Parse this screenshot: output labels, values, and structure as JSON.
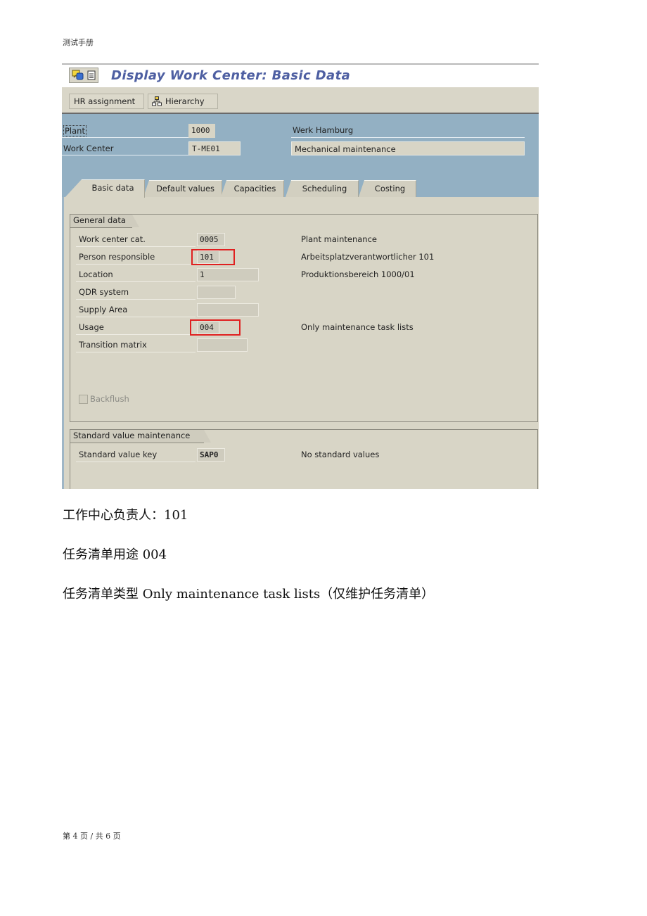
{
  "document": {
    "header": "测试手册",
    "footer": "第 4 页 / 共 6 页"
  },
  "sap": {
    "title": "Display Work Center: Basic Data",
    "title_icons": [
      "help-icon",
      "document-icon"
    ],
    "toolbar": {
      "hr_assignment": "HR assignment",
      "hierarchy": "Hierarchy"
    },
    "header": {
      "plant_label": "Plant",
      "plant_value": "1000",
      "plant_desc": "Werk Hamburg",
      "work_center_label": "Work Center",
      "work_center_value": "T-ME01",
      "work_center_desc": "Mechanical maintenance"
    },
    "tabs": [
      {
        "label": "Basic data",
        "active": true
      },
      {
        "label": "Default values",
        "active": false
      },
      {
        "label": "Capacities",
        "active": false
      },
      {
        "label": "Scheduling",
        "active": false
      },
      {
        "label": "Costing",
        "active": false
      }
    ],
    "general_data": {
      "title": "General data",
      "rows": [
        {
          "label": "Work center cat.",
          "value": "0005",
          "desc": "Plant maintenance"
        },
        {
          "label": "Person responsible",
          "value": "101",
          "desc": "Arbeitsplatzverantwortlicher 101",
          "highlighted": true
        },
        {
          "label": "Location",
          "value": "1",
          "desc": "Produktionsbereich 1000/01"
        },
        {
          "label": "QDR system",
          "value": "",
          "desc": ""
        },
        {
          "label": "Supply Area",
          "value": "",
          "desc": ""
        },
        {
          "label": "Usage",
          "value": "004",
          "desc": "Only maintenance task lists",
          "highlighted": true
        },
        {
          "label": "Transition matrix",
          "value": "",
          "desc": ""
        }
      ],
      "backflush_label": "Backflush",
      "backflush_checked": false
    },
    "standard_value": {
      "title": "Standard value maintenance",
      "key_label": "Standard value key",
      "key_value": "SAP0",
      "key_desc": "No standard values"
    }
  },
  "notes": [
    "工作中心负责人：101",
    "任务清单用途 004",
    "任务清单类型 Only  maintenance task lists（仅维护任务清单）"
  ]
}
